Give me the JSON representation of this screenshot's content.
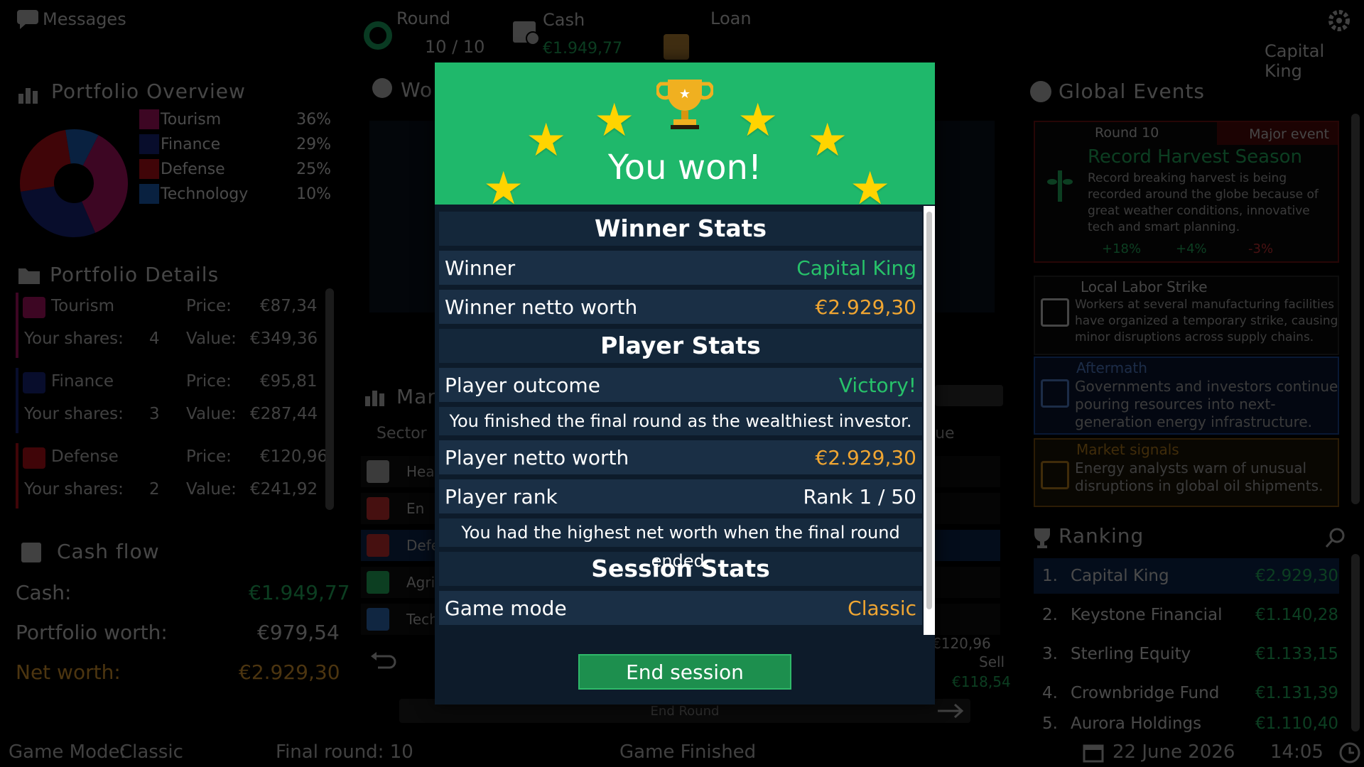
{
  "topbar": {
    "messages_label": "Messages",
    "round_label": "Round",
    "round_value": "10 / 10",
    "cash_label": "Cash",
    "cash_value": "€1.949,77",
    "loan_label": "Loan",
    "player_name": "Capital King"
  },
  "portfolio_overview": {
    "title": "Portfolio Overview",
    "items": [
      {
        "label": "Tourism",
        "pct": "36%",
        "value": 36,
        "color": "#c0146e"
      },
      {
        "label": "Finance",
        "pct": "29%",
        "value": 29,
        "color": "#1a2a8c"
      },
      {
        "label": "Defense",
        "pct": "25%",
        "value": 25,
        "color": "#c8101a"
      },
      {
        "label": "Technology",
        "pct": "10%",
        "value": 10,
        "color": "#1e6ac8"
      }
    ]
  },
  "portfolio_details": {
    "title": "Portfolio Details",
    "price_label": "Price:",
    "shares_label": "Your shares:",
    "value_label": "Value:",
    "items": [
      {
        "name": "Tourism",
        "price": "€87,34",
        "shares": "4",
        "value": "€349,36",
        "color": "#c0146e"
      },
      {
        "name": "Finance",
        "price": "€95,81",
        "shares": "3",
        "value": "€287,44",
        "color": "#1a2a8c"
      },
      {
        "name": "Defense",
        "price": "€120,96",
        "shares": "2",
        "value": "€241,92",
        "color": "#c8101a"
      }
    ]
  },
  "cash_flow": {
    "title": "Cash flow",
    "cash_label": "Cash:",
    "cash_value": "€1.949,77",
    "portfolio_label": "Portfolio worth:",
    "portfolio_value": "€979,54",
    "net_label": "Net worth:",
    "net_value": "€2.929,30"
  },
  "center": {
    "world_title": "Wo",
    "market_title": "Mar",
    "sector_header": "Sector",
    "value_header": "lue",
    "rows": [
      "Heal",
      "En",
      "Defe",
      "Agri",
      "Tech"
    ],
    "price_snippet": "€120,96",
    "sell_label": "Sell",
    "sub_value": "€118,54",
    "end_round_label": "End Round"
  },
  "modal": {
    "title": "You won!",
    "winner_stats_title": "Winner Stats",
    "winner_label": "Winner",
    "winner_value": "Capital King",
    "winner_worth_label": "Winner netto worth",
    "winner_worth_value": "€2.929,30",
    "player_stats_title": "Player Stats",
    "outcome_label": "Player outcome",
    "outcome_value": "Victory!",
    "outcome_note": "You finished the final round as the wealthiest investor.",
    "player_worth_label": "Player netto worth",
    "player_worth_value": "€2.929,30",
    "rank_label": "Player rank",
    "rank_value": "Rank 1 / 50",
    "rank_note": "You had the highest net worth when the final round ended.",
    "session_stats_title": "Session Stats",
    "mode_label": "Game mode",
    "mode_value": "Classic",
    "end_button": "End session"
  },
  "global_events": {
    "title": "Global Events",
    "major": {
      "round": "Round 10",
      "tag": "Major event",
      "title": "Record Harvest Season",
      "text": "Record breaking harvest is being recorded around the globe because of great weather conditions, innovative tech and smart planning.",
      "effects": [
        "+18%",
        "+4%",
        "-3%"
      ]
    },
    "events": [
      {
        "title": "Local Labor Strike",
        "text": "Workers at several manufacturing facilities have organized a temporary strike, causing minor disruptions across supply chains."
      },
      {
        "title": "Aftermath",
        "text": "Governments and investors continue pouring resources into next-generation energy infrastructure."
      },
      {
        "title": "Market signals",
        "text": "Energy analysts warn of unusual disruptions in global oil shipments."
      }
    ]
  },
  "ranking": {
    "title": "Ranking",
    "rows": [
      {
        "pos": "1.",
        "name": "Capital King",
        "value": "€2.929,30"
      },
      {
        "pos": "2.",
        "name": "Keystone Financial",
        "value": "€1.140,28"
      },
      {
        "pos": "3.",
        "name": "Sterling Equity",
        "value": "€1.133,15"
      },
      {
        "pos": "4.",
        "name": "Crownbridge Fund",
        "value": "€1.131,39"
      },
      {
        "pos": "5.",
        "name": "Aurora Holdings",
        "value": "€1.110,40"
      }
    ]
  },
  "footer": {
    "mode_label": "Game Mode:",
    "mode_value": "Classic",
    "final_round": "Final round: 10",
    "status": "Game Finished",
    "date": "22 June 2026",
    "time": "14:05"
  }
}
